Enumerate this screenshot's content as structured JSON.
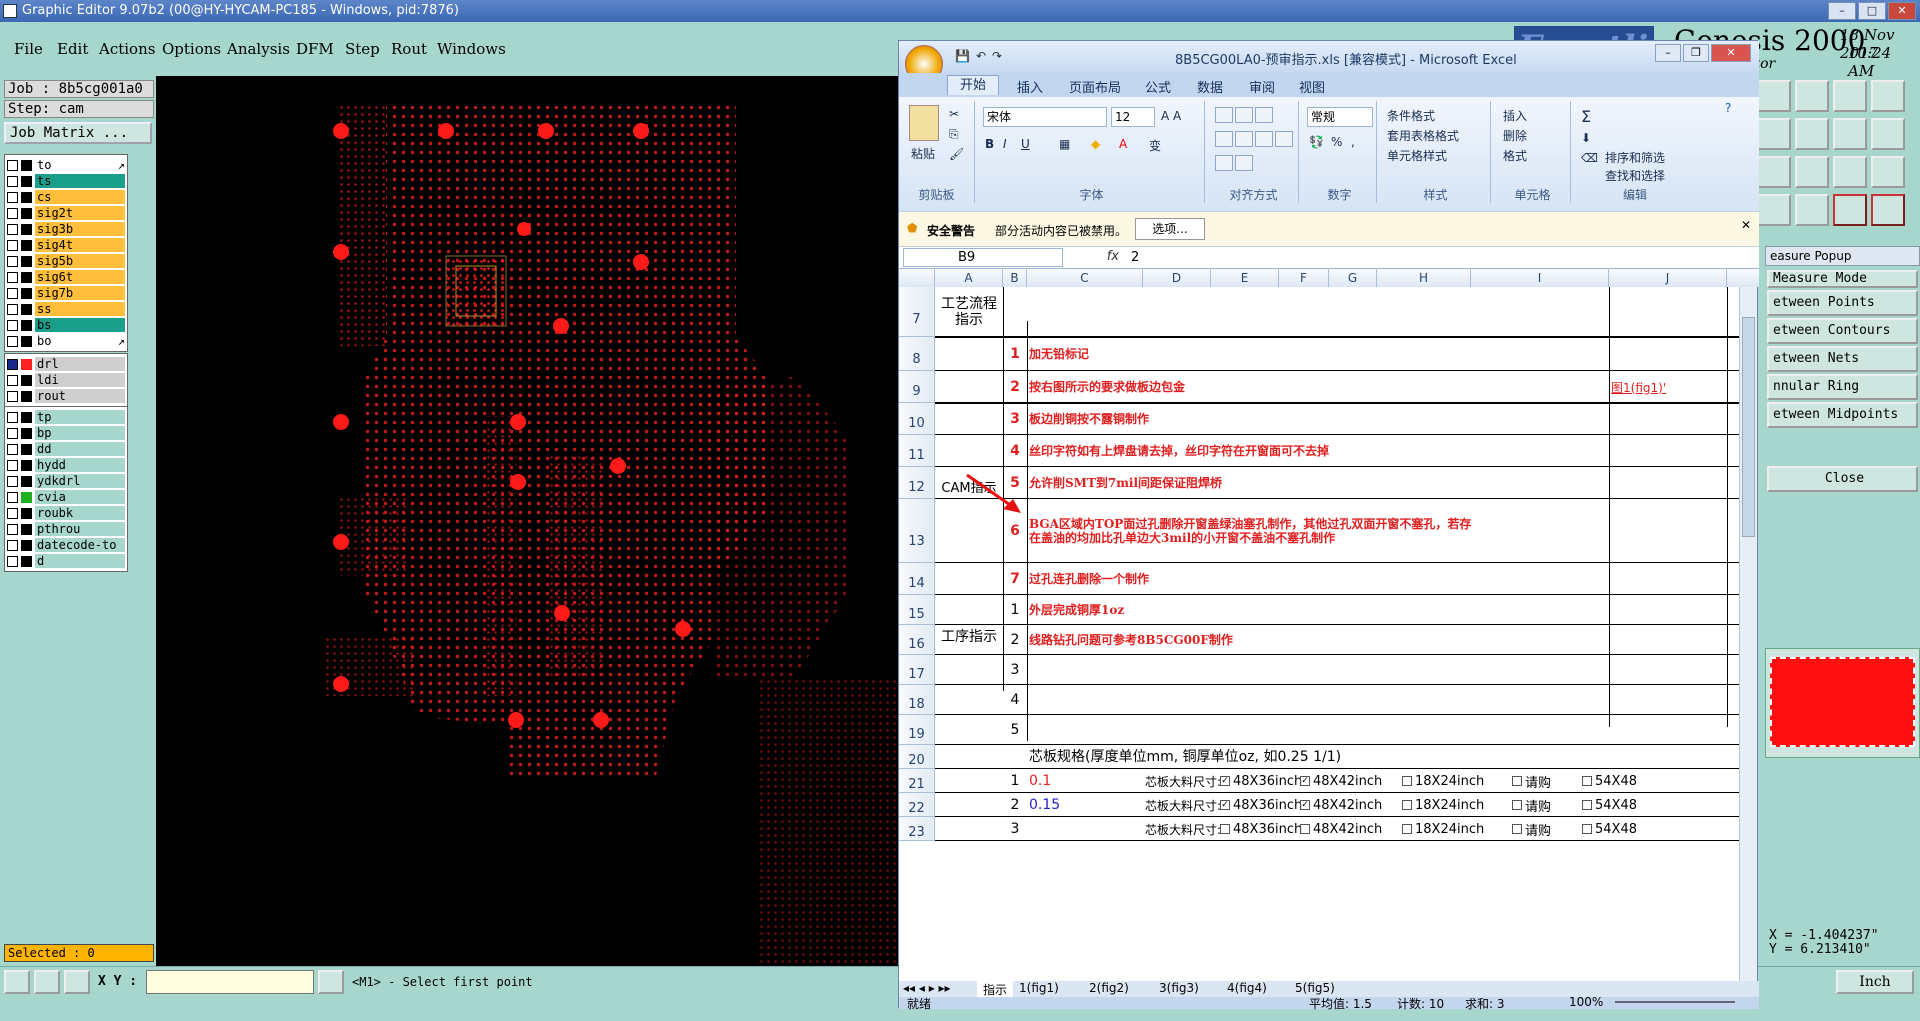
{
  "genesis": {
    "window_title": "Graphic Editor 9.07b2 (00@HY-HYCAM-PC185 - Windows, pid:7876)",
    "menus": [
      "File",
      "Edit",
      "Actions",
      "Options",
      "Analysis",
      "DFM",
      "Step",
      "Rout",
      "Windows"
    ],
    "brand_logo": "Frontline",
    "product": "Genesis 2000",
    "date": "18 Nov 2017",
    "time": "10:24 AM",
    "editor_label": "itor",
    "job_line": "Job : 8b5cg001a0",
    "step_line": "Step: cam",
    "job_matrix_button": "Job Matrix ...",
    "layers_group1": [
      {
        "name": "to",
        "color": "#ffffff",
        "marker": "↗"
      },
      {
        "name": "ts",
        "color": "#1aa08a"
      },
      {
        "name": "cs",
        "color": "#ffbe3c"
      },
      {
        "name": "sig2t",
        "color": "#ffbe3c"
      },
      {
        "name": "sig3b",
        "color": "#ffbe3c"
      },
      {
        "name": "sig4t",
        "color": "#ffbe3c"
      },
      {
        "name": "sig5b",
        "color": "#ffbe3c"
      },
      {
        "name": "sig6t",
        "color": "#ffbe3c"
      },
      {
        "name": "sig7b",
        "color": "#ffbe3c"
      },
      {
        "name": "ss",
        "color": "#ffbe3c"
      },
      {
        "name": "bs",
        "color": "#1aa08a"
      },
      {
        "name": "bo",
        "color": "#ffffff",
        "marker": "↗"
      }
    ],
    "layers_group2": [
      {
        "name": "drl",
        "color": "#cfcfcf",
        "swatch": "#ff2020",
        "checked": true
      },
      {
        "name": "ldi",
        "color": "#cfcfcf"
      },
      {
        "name": "rout",
        "color": "#cfcfcf"
      }
    ],
    "layers_group3": [
      {
        "name": "tp",
        "color": "#a6d6cc"
      },
      {
        "name": "bp",
        "color": "#a6d6cc"
      },
      {
        "name": "dd",
        "color": "#a6d6cc"
      },
      {
        "name": "hydd",
        "color": "#a6d6cc"
      },
      {
        "name": "ydkdrl",
        "color": "#a6d6cc"
      },
      {
        "name": "cvia",
        "color": "#a6d6cc",
        "swatch": "#20b020"
      },
      {
        "name": "roubk",
        "color": "#a6d6cc"
      },
      {
        "name": "pthrou",
        "color": "#a6d6cc"
      },
      {
        "name": "datecode-to",
        "color": "#a6d6cc"
      },
      {
        "name": "d",
        "color": "#a6d6cc"
      }
    ],
    "selected": "Selected : 0",
    "xy_label": "X Y :",
    "prompt": "<M1> - Select first point",
    "units_button": "Inch",
    "measure_popup": {
      "title": "easure Popup",
      "mode_label": "Measure Mode",
      "options": [
        "etween Points",
        "etween Contours",
        "etween Nets",
        "nnular Ring",
        "etween Midpoints"
      ],
      "close": "Close"
    },
    "coord_x": "X = -1.404237\"",
    "coord_y": "Y = 6.213410\"",
    "colors": {
      "panel_bg": "#a6d6cc",
      "canvas_bg": "#000000",
      "feature_red": "#e51c1c"
    }
  },
  "excel": {
    "title": "8B5CG00LA0-预审指示.xls  [兼容模式] - Microsoft Excel",
    "tabs": [
      "开始",
      "插入",
      "页面布局",
      "公式",
      "数据",
      "审阅",
      "视图"
    ],
    "ribbon": {
      "clipboard": {
        "paste": "粘贴",
        "label": "剪贴板"
      },
      "font": {
        "name": "宋体",
        "size": "12",
        "label": "字体"
      },
      "alignment": {
        "label": "对齐方式"
      },
      "number": {
        "format": "常规",
        "label": "数字"
      },
      "styles": {
        "items": [
          "条件格式",
          "套用表格格式",
          "单元格样式"
        ],
        "label": "样式"
      },
      "cells": {
        "items": [
          "插入",
          "删除",
          "格式"
        ],
        "label": "单元格"
      },
      "editing": {
        "items": [
          "排序和筛选",
          "查找和选择"
        ],
        "label": "编辑"
      }
    },
    "security": {
      "title": "安全警告",
      "message": "部分活动内容已被禁用。",
      "options_button": "选项..."
    },
    "name_box": "B9",
    "fx": "fx",
    "formula_value": "2",
    "columns": [
      "A",
      "B",
      "C",
      "D",
      "E",
      "F",
      "G",
      "H",
      "I",
      "J"
    ],
    "rows": [
      {
        "num": "7",
        "a": "工艺流程指示",
        "b": "",
        "text": "",
        "j": ""
      },
      {
        "num": "8",
        "a": "",
        "b": "1",
        "text": "加无铅标记",
        "j": ""
      },
      {
        "num": "9",
        "a": "",
        "b": "2",
        "text": "按右图所示的要求做板边包金",
        "j": "图1(fig1)'"
      },
      {
        "num": "10",
        "a": "",
        "b": "3",
        "text": "板边削铜按不露铜制作",
        "j": ""
      },
      {
        "num": "11",
        "a": "CAM指示",
        "b": "4",
        "text": "丝印字符如有上焊盘请去掉，丝印字符在开窗面可不去掉",
        "j": ""
      },
      {
        "num": "12",
        "a": "",
        "b": "5",
        "text": "允许削SMT到7mil间距保证阻焊桥",
        "j": ""
      },
      {
        "num": "13",
        "a": "",
        "b": "6",
        "text": "BGA区域内TOP面过孔删除开窗盖绿油塞孔制作，其他过孔双面开窗不塞孔，若存在盖油的均加比孔单边大3mil的小开窗不盖油不塞孔制作",
        "j": ""
      },
      {
        "num": "14",
        "a": "",
        "b": "7",
        "text": "过孔连孔删除一个制作",
        "j": ""
      },
      {
        "num": "15",
        "a": "",
        "b": "1",
        "text": "外层完成铜厚1oz",
        "j": ""
      },
      {
        "num": "16",
        "a": "",
        "b": "2",
        "text": "线路钻孔问题可参考8B5CG00F制作",
        "j": ""
      },
      {
        "num": "17",
        "a": "工序指示",
        "b": "3",
        "text": "",
        "j": ""
      },
      {
        "num": "18",
        "a": "",
        "b": "4",
        "text": "",
        "j": ""
      },
      {
        "num": "19",
        "a": "",
        "b": "5",
        "text": "",
        "j": ""
      },
      {
        "num": "20",
        "a": "",
        "b": "",
        "text": "芯板规格(厚度单位mm, 铜厚单位oz, 如0.25 1/1)",
        "j": ""
      },
      {
        "num": "21",
        "a": "",
        "b": "1",
        "c": "0.1",
        "label": "芯板大料尺寸:",
        "sizes": [
          "48X36inch",
          "48X42inch",
          "18X24inch",
          "请购",
          "54X48"
        ],
        "checked": [
          true,
          true,
          false,
          false,
          false
        ]
      },
      {
        "num": "22",
        "a": "",
        "b": "2",
        "c": "0.15",
        "label": "芯板大料尺寸:",
        "sizes": [
          "48X36inch",
          "48X42inch",
          "18X24inch",
          "请购",
          "54X48"
        ],
        "checked": [
          true,
          true,
          false,
          false,
          false
        ]
      },
      {
        "num": "23",
        "a": "",
        "b": "3",
        "c": "",
        "label": "芯板大料尺寸:",
        "sizes": [
          "48X36inch",
          "48X42inch",
          "18X24inch",
          "请购",
          "54X48"
        ],
        "checked": [
          false,
          false,
          false,
          false,
          false
        ]
      }
    ],
    "sheet_tabs": [
      "指示",
      "1(fig1)",
      "2(fig2)",
      "3(fig3)",
      "4(fig4)",
      "5(fig5)"
    ],
    "status": {
      "ready": "就绪",
      "average": "平均值: 1.5",
      "count": "计数: 10",
      "sum": "求和: 3",
      "zoom": "100%"
    }
  }
}
